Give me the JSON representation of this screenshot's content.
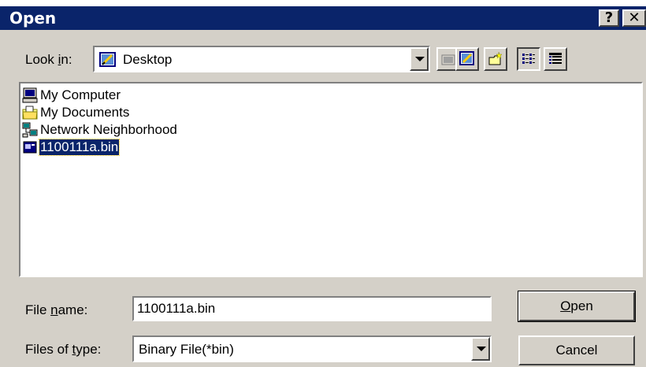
{
  "window": {
    "title": "Open",
    "help_label": "?",
    "close_label": "✕"
  },
  "lookin": {
    "label_pre": "Look ",
    "label_mnemonic": "i",
    "label_post": "n:",
    "value": "Desktop",
    "icon": "desktop-icon"
  },
  "toolbar": [
    {
      "name": "up-one-level-icon"
    },
    {
      "name": "desktop-icon"
    },
    {
      "name": "new-folder-icon"
    },
    {
      "name": "list-view-icon"
    },
    {
      "name": "details-view-icon"
    }
  ],
  "files": [
    {
      "label": "My Computer",
      "icon": "my-computer-icon",
      "selected": false
    },
    {
      "label": "My Documents",
      "icon": "my-documents-folder-icon",
      "selected": false
    },
    {
      "label": "Network Neighborhood",
      "icon": "network-neighborhood-icon",
      "selected": false
    },
    {
      "label": "1100111a.bin",
      "icon": "bin-file-icon",
      "selected": true
    }
  ],
  "filename": {
    "label_pre": "File ",
    "label_mnemonic": "n",
    "label_post": "ame:",
    "value": "1100111a.bin"
  },
  "filetype": {
    "label_pre": "Files of ",
    "label_mnemonic": "t",
    "label_post": "ype:",
    "value": "Binary File(*bin)"
  },
  "buttons": {
    "open_mnemonic": "O",
    "open_rest": "pen",
    "cancel": "Cancel"
  },
  "colors": {
    "titlebar": "#0a246a",
    "face": "#d4d0c8",
    "selection": "#0a246a"
  }
}
